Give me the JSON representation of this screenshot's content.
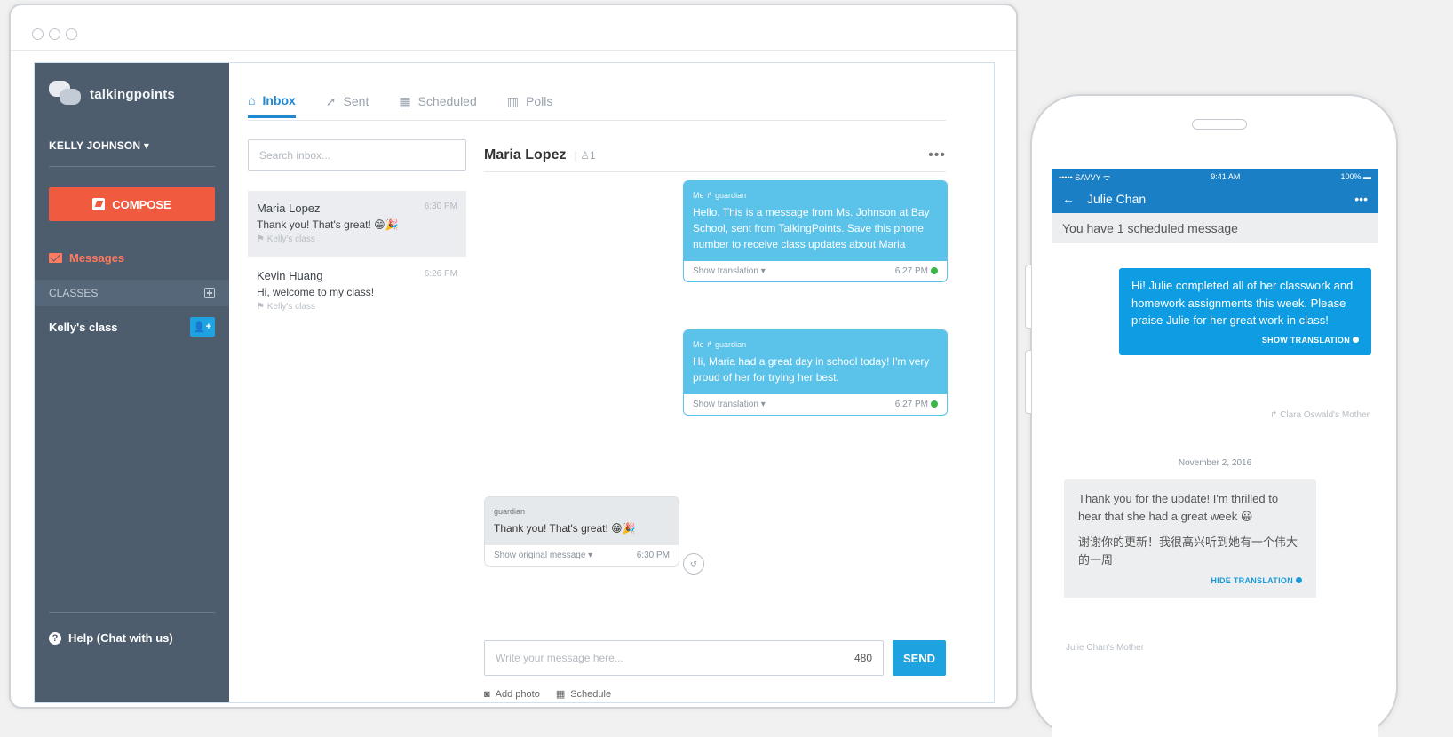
{
  "app": {
    "brand": "talkingpoints",
    "user": "KELLY JOHNSON ▾",
    "compose": "COMPOSE",
    "nav_messages": "Messages",
    "classes_label": "CLASSES",
    "class_name": "Kelly's class",
    "add_member": "+",
    "help": "Help (Chat with us)"
  },
  "tabs": [
    {
      "label": "Inbox",
      "icon": "inbox-icon"
    },
    {
      "label": "Sent",
      "icon": "send-icon"
    },
    {
      "label": "Scheduled",
      "icon": "calendar-icon"
    },
    {
      "label": "Polls",
      "icon": "bar-chart-icon"
    }
  ],
  "search": {
    "placeholder": "Search inbox..."
  },
  "conversations": [
    {
      "name": "Maria Lopez",
      "time": "6:30 PM",
      "preview": "Thank you! That's great! 😁🎉",
      "class": "Kelly's class"
    },
    {
      "name": "Kevin Huang",
      "time": "6:26 PM",
      "preview": "Hi, welcome to my class!",
      "class": "Kelly's class"
    }
  ],
  "thread": {
    "name": "Maria Lopez",
    "count": "1",
    "more": "•••",
    "messages_out": [
      {
        "meta": "Me ↱ guardian",
        "text": "Hello. This is a message from Ms. Johnson at Bay School, sent from TalkingPoints. Save this phone number to receive class updates about Maria",
        "footer": "Show translation ▾",
        "time": "6:27 PM"
      },
      {
        "meta": "Me ↱ guardian",
        "text": "Hi, Maria had a great day in school today! I'm very proud of her for trying her best.",
        "footer": "Show translation ▾",
        "time": "6:27 PM"
      }
    ],
    "message_in": {
      "meta": "guardian",
      "text": "Thank you! That's great! 😁🎉",
      "footer": "Show original message ▾",
      "time": "6:30 PM"
    },
    "compose_placeholder": "Write your message here...",
    "char_count": "480",
    "send": "SEND",
    "add_photo": "Add photo",
    "schedule": "Schedule"
  },
  "phone": {
    "carrier": "••••• SAVVY ᯤ",
    "clock": "9:41 AM",
    "battery": "100%",
    "contact": "Julie Chan",
    "more": "•••",
    "banner": "You have 1 scheduled message",
    "out_text": "Hi! Julie completed all of her classwork and homework assignments this week. Please praise Julie for her great work in class!",
    "show_translation": "SHOW TRANSLATION",
    "out_sender": "↱ Clara Oswald's Mother",
    "date": "November 2, 2016",
    "in_text": "Thank you for the update! I'm thrilled to hear that she had a great week 😀",
    "in_translated": "谢谢你的更新！我很高兴听到她有一个伟大的一周",
    "hide_translation": "HIDE TRANSLATION",
    "in_sender": "Julie Chan's Mother"
  }
}
